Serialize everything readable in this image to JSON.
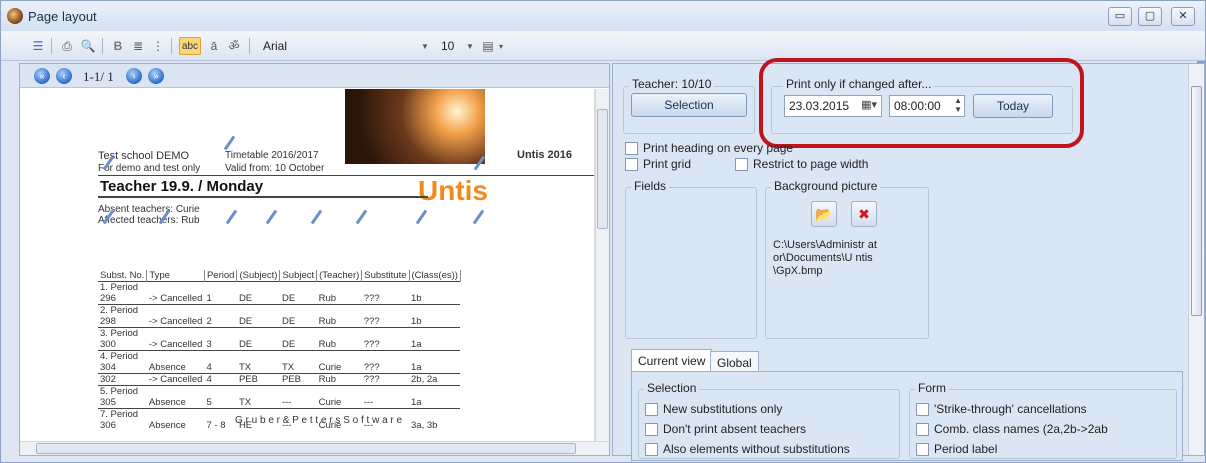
{
  "window": {
    "title": "Page layout",
    "controls": [
      "▭",
      "▢",
      "✕"
    ]
  },
  "toolbar": {
    "font_name": "Arial",
    "font_size": "10",
    "abc_label": "abc",
    "bold_label": "B"
  },
  "preview": {
    "page_indicator": "1-1/ 1",
    "school": "Test school  DEMO",
    "demo_note": "For demo and test only",
    "timetable": "Timetable 2016/2017",
    "valid_from": "Valid from: 10 October",
    "brand": "Untis 2016",
    "heading": "Teacher  19.9. / Monday",
    "logo": "Untis",
    "absent_teachers": "Absent teachers:  Curie",
    "affected_teachers": "Affected teachers:  Rub",
    "footer": "G r u b e r  &  P e t t e r s  S o f t w a r e",
    "columns": [
      "Subst. No.",
      "Type",
      "Period",
      "(Subject)",
      "Subject",
      "(Teacher)",
      "Substitute",
      "(Class(es))"
    ],
    "rows": [
      {
        "period": "1. Period",
        "cells": [
          "296",
          "-> Cancelled",
          "1",
          "DE",
          "DE",
          "Rub",
          "???",
          "1b"
        ]
      },
      {
        "period": "2. Period",
        "cells": [
          "298",
          "-> Cancelled",
          "2",
          "DE",
          "DE",
          "Rub",
          "???",
          "1b"
        ]
      },
      {
        "period": "3. Period",
        "cells": [
          "300",
          "-> Cancelled",
          "3",
          "DE",
          "DE",
          "Rub",
          "???",
          "1a"
        ]
      },
      {
        "period": "4. Period",
        "cells": [
          "304",
          "Absence",
          "4",
          "TX",
          "TX",
          "Curie",
          "???",
          "1a"
        ]
      },
      {
        "period": "",
        "cells": [
          "302",
          "-> Cancelled",
          "4",
          "PEB",
          "PEB",
          "Rub",
          "???",
          "2b, 2a"
        ]
      },
      {
        "period": "5. Period",
        "cells": [
          "305",
          "Absence",
          "5",
          "TX",
          "---",
          "Curie",
          "---",
          "1a"
        ]
      },
      {
        "period": "7. Period",
        "cells": [
          "306",
          "Absence",
          "7 - 8",
          "HE",
          "---",
          "Curie",
          "---",
          "3a, 3b"
        ]
      }
    ]
  },
  "settings": {
    "teacher_label": "Teacher: 10/10",
    "selection_button": "Selection",
    "print_only_label": "Print only if changed after...",
    "date_value": "23.03.2015",
    "time_value": "08:00:00",
    "today_button": "Today",
    "print_heading": "Print heading on every page",
    "print_grid": "Print grid",
    "restrict_width": "Restrict to page width",
    "fields_label": "Fields",
    "background_label": "Background picture",
    "bg_path": "C:\\Users\\Administr ator\\Documents\\U ntis\\GpX.bmp",
    "tab_current": "Current view",
    "tab_global": "Global",
    "selection_label": "Selection",
    "form_label": "Form",
    "opt_new_subst": "New substitutions only",
    "opt_no_absent": "Don't print absent teachers",
    "opt_also_elements": "Also elements without substitutions",
    "opt_strike": "'Strike-through' cancellations",
    "opt_comb": "Comb.  class  names  (2a,2b->2ab",
    "opt_period_label": "Period label"
  },
  "colors": {
    "highlight": "#c0141c",
    "accent": "#f08a1a"
  }
}
